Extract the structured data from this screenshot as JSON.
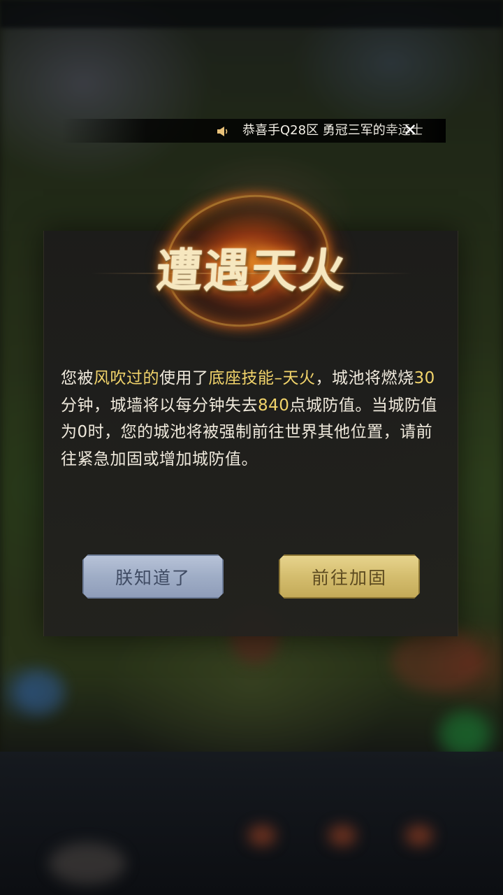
{
  "notice": {
    "text": "恭喜手Q28区  勇冠三军的",
    "text_tail": "幸运士"
  },
  "dialog": {
    "title": "遭遇天火",
    "message": {
      "p1": "您被",
      "attacker": "风吹过的",
      "p2": "使用了",
      "skill": "底座技能–天火",
      "p3": "，城池将燃烧",
      "minutes": "30",
      "p4": "分钟，城墙将以每分钟失去",
      "defense_loss": "840",
      "p5": "点城防值。当城防值为0时，您的城池将被强制前往世界其他位置，请前往紧急加固或增加城防值。"
    },
    "buttons": {
      "acknowledge": "朕知道了",
      "reinforce": "前往加固"
    }
  },
  "colors": {
    "highlight": "#f2d46b",
    "message_text": "#efe9dc",
    "acknowledge_button": "#a8b5cd",
    "reinforce_button": "#d9c277"
  },
  "icons": {
    "speaker": "speaker-icon",
    "close": "close-icon"
  }
}
